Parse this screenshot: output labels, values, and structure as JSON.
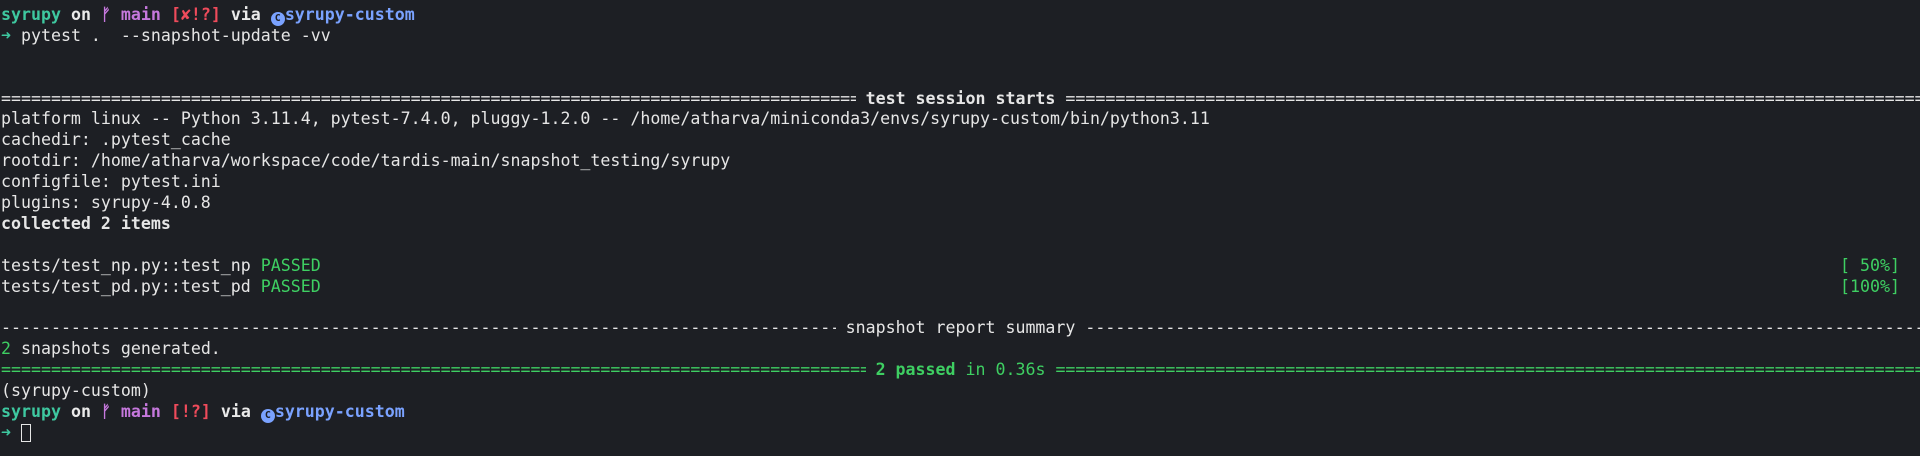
{
  "prompt1": {
    "dir": "syrupy",
    "on": "on",
    "branch_icon": "git-branch-icon",
    "branch": "main",
    "status": "[✘!?]",
    "via": "via",
    "env_icon": "conda-icon",
    "env": "syrupy-custom",
    "arrow": "➜",
    "command": "pytest .  --snapshot-update -vv"
  },
  "session": {
    "title": " test session starts ",
    "platform": "platform linux -- Python 3.11.4, pytest-7.4.0, pluggy-1.2.0 -- /home/atharva/miniconda3/envs/syrupy-custom/bin/python3.11",
    "cachedir": "cachedir: .pytest_cache",
    "rootdir": "rootdir: /home/atharva/workspace/code/tardis-main/snapshot_testing/syrupy",
    "configfile": "configfile: pytest.ini",
    "plugins": "plugins: syrupy-4.0.8",
    "collected": "collected 2 items"
  },
  "tests": [
    {
      "name": "tests/test_np.py::test_np",
      "status": "PASSED",
      "progress": "[ 50%]"
    },
    {
      "name": "tests/test_pd.py::test_pd",
      "status": "PASSED",
      "progress": "[100%]"
    }
  ],
  "snapshot": {
    "title": " snapshot report summary ",
    "count": "2",
    "generated_text": " snapshots generated."
  },
  "summary": {
    "passed": "2 passed",
    "time": " in 0.36s"
  },
  "env_line": "(syrupy-custom)",
  "prompt2": {
    "dir": "syrupy",
    "on": "on",
    "branch": "main",
    "status": "[!?]",
    "via": "via",
    "env": "syrupy-custom",
    "arrow": "➜"
  },
  "colors": {
    "background": "#1d1f24",
    "teal": "#3ec8a0",
    "magenta": "#c678dd",
    "red": "#ef4b5b",
    "blue": "#7aa2ff",
    "green": "#3ecf62"
  }
}
